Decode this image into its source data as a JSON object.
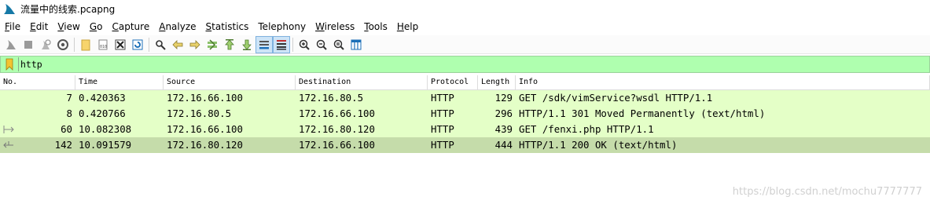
{
  "window": {
    "title": "流量中的线索.pcapng"
  },
  "menu": [
    {
      "label": "File",
      "acc": "F",
      "rest": "ile"
    },
    {
      "label": "Edit",
      "acc": "E",
      "rest": "dit"
    },
    {
      "label": "View",
      "acc": "V",
      "rest": "iew"
    },
    {
      "label": "Go",
      "acc": "G",
      "rest": "o"
    },
    {
      "label": "Capture",
      "acc": "C",
      "rest": "apture"
    },
    {
      "label": "Analyze",
      "acc": "A",
      "rest": "nalyze"
    },
    {
      "label": "Statistics",
      "acc": "S",
      "rest": "tatistics"
    },
    {
      "label": "Telephony",
      "acc": "",
      "rest": "Telephony"
    },
    {
      "label": "Wireless",
      "acc": "W",
      "rest": "ireless"
    },
    {
      "label": "Tools",
      "acc": "T",
      "rest": "ools"
    },
    {
      "label": "Help",
      "acc": "H",
      "rest": "elp"
    }
  ],
  "filter": {
    "value": "http"
  },
  "columns": [
    "No.",
    "Time",
    "Source",
    "Destination",
    "Protocol",
    "Length",
    "Info"
  ],
  "rows": [
    {
      "no": "7",
      "time": "0.420363",
      "source": "172.16.66.100",
      "destination": "172.16.80.5",
      "protocol": "HTTP",
      "length": "129",
      "info": "GET /sdk/vimService?wsdl HTTP/1.1"
    },
    {
      "no": "8",
      "time": "0.420766",
      "source": "172.16.80.5",
      "destination": "172.16.66.100",
      "protocol": "HTTP",
      "length": "296",
      "info": "HTTP/1.1 301 Moved Permanently  (text/html)"
    },
    {
      "no": "60",
      "time": "10.082308",
      "source": "172.16.66.100",
      "destination": "172.16.80.120",
      "protocol": "HTTP",
      "length": "439",
      "info": "GET /fenxi.php HTTP/1.1"
    },
    {
      "no": "142",
      "time": "10.091579",
      "source": "172.16.80.120",
      "destination": "172.16.66.100",
      "protocol": "HTTP",
      "length": "444",
      "info": "HTTP/1.1 200 OK  (text/html)"
    }
  ],
  "colors": {
    "row_normal": "#e4ffc7",
    "row_selected": "#c5dcaa",
    "filter_bg": "#afffaf"
  },
  "watermark": "https://blog.csdn.net/mochu7777777"
}
